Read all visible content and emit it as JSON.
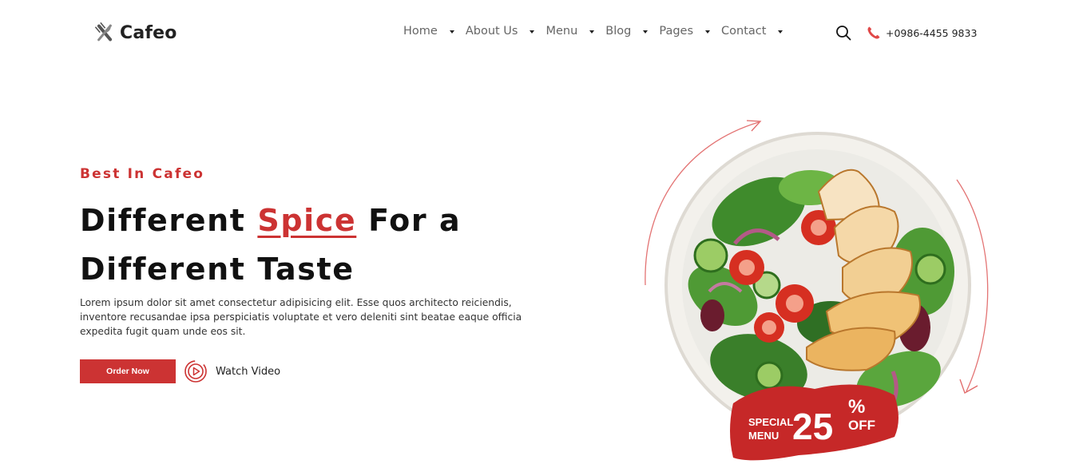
{
  "brand": {
    "name": "Cafeo",
    "logo_icon": "fork-knife-icon"
  },
  "nav": {
    "items": [
      {
        "label": "Home"
      },
      {
        "label": "About Us"
      },
      {
        "label": "Menu"
      },
      {
        "label": "Blog"
      },
      {
        "label": "Pages"
      },
      {
        "label": "Contact"
      }
    ]
  },
  "header": {
    "search_icon": "search-icon",
    "phone_icon": "phone-icon",
    "phone": "+0986-4455 9833"
  },
  "hero": {
    "eyebrow": "Best In Cafeo",
    "headline_before": "Different ",
    "headline_accent": "Spice",
    "headline_after": " For a Different Taste",
    "body": "Lorem ipsum dolor sit amet consectetur adipisicing elit. Esse quos architecto reiciendis, inventore recusandae ipsa perspiciatis voluptate et vero deleniti sint beatae eaque officia expedita fugit quam unde eos sit.",
    "order_button": "Order Now",
    "watch_label": "Watch Video",
    "watch_icon": "play-circle-icon"
  },
  "badge": {
    "line1": "SPECIAL",
    "line2": "MENU",
    "value": "25",
    "percent": "%",
    "off": "OFF"
  },
  "colors": {
    "accent": "#cc3333",
    "text": "#111111",
    "nav": "#666666"
  }
}
